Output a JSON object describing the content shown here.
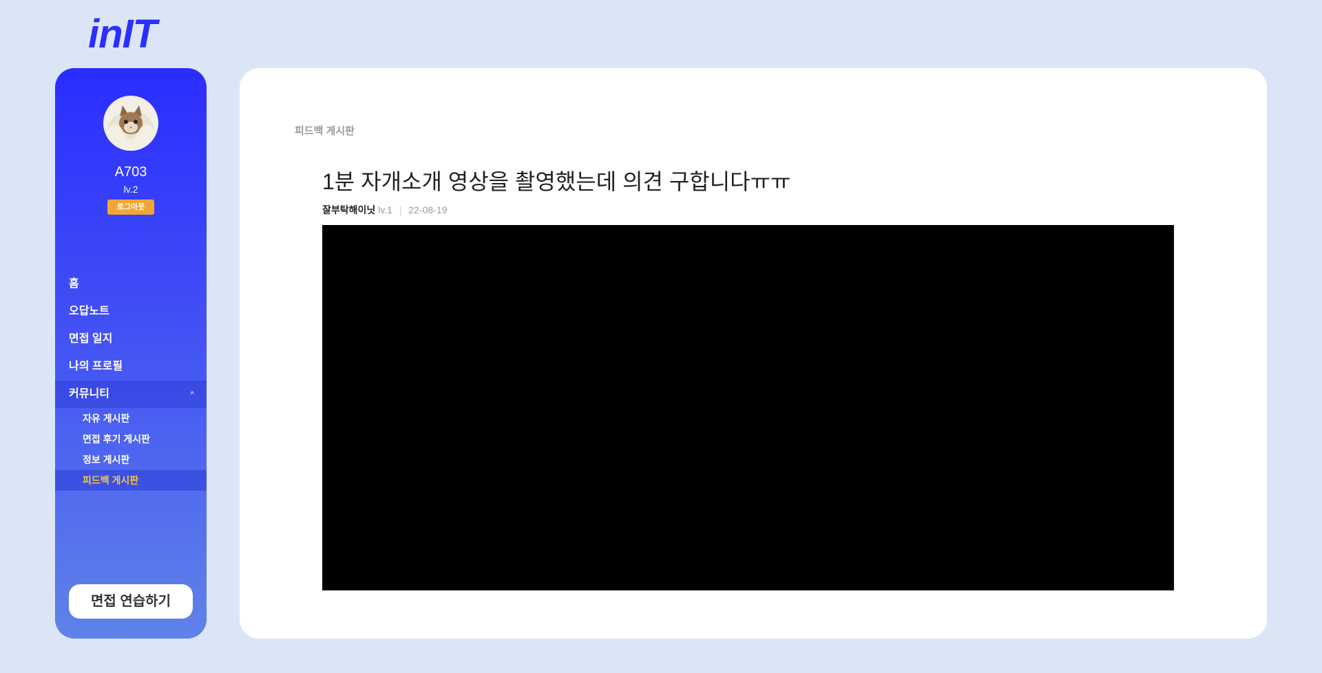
{
  "logo": "inIT",
  "user": {
    "name": "A703",
    "level": "lv.2",
    "logout_label": "로그아웃"
  },
  "nav": {
    "home": "홈",
    "notes": "오답노트",
    "journal": "면접 일지",
    "profile": "나의 프로필",
    "community": "커뮤니티",
    "community_chevron": "^",
    "sub": {
      "free": "자유 게시판",
      "review": "면접 후기 게시판",
      "info": "정보 게시판",
      "feedback": "피드백 게시판"
    }
  },
  "practice_button": "면접 연습하기",
  "content": {
    "breadcrumb": "피드백 게시판",
    "post": {
      "title": "1분 자개소개 영상을 촬영했는데 의견 구합니다ㅠㅠ",
      "author": "잘부탁해이닛",
      "author_level": "lv.1",
      "date": "22-08-19"
    }
  },
  "colors": {
    "background": "#dce5f5",
    "brand": "#2a2fff",
    "accent": "#f0a634",
    "active_nav": "#f6c24a"
  },
  "icons": {
    "chevron": "chevron-up-icon",
    "avatar": "cat-avatar"
  }
}
